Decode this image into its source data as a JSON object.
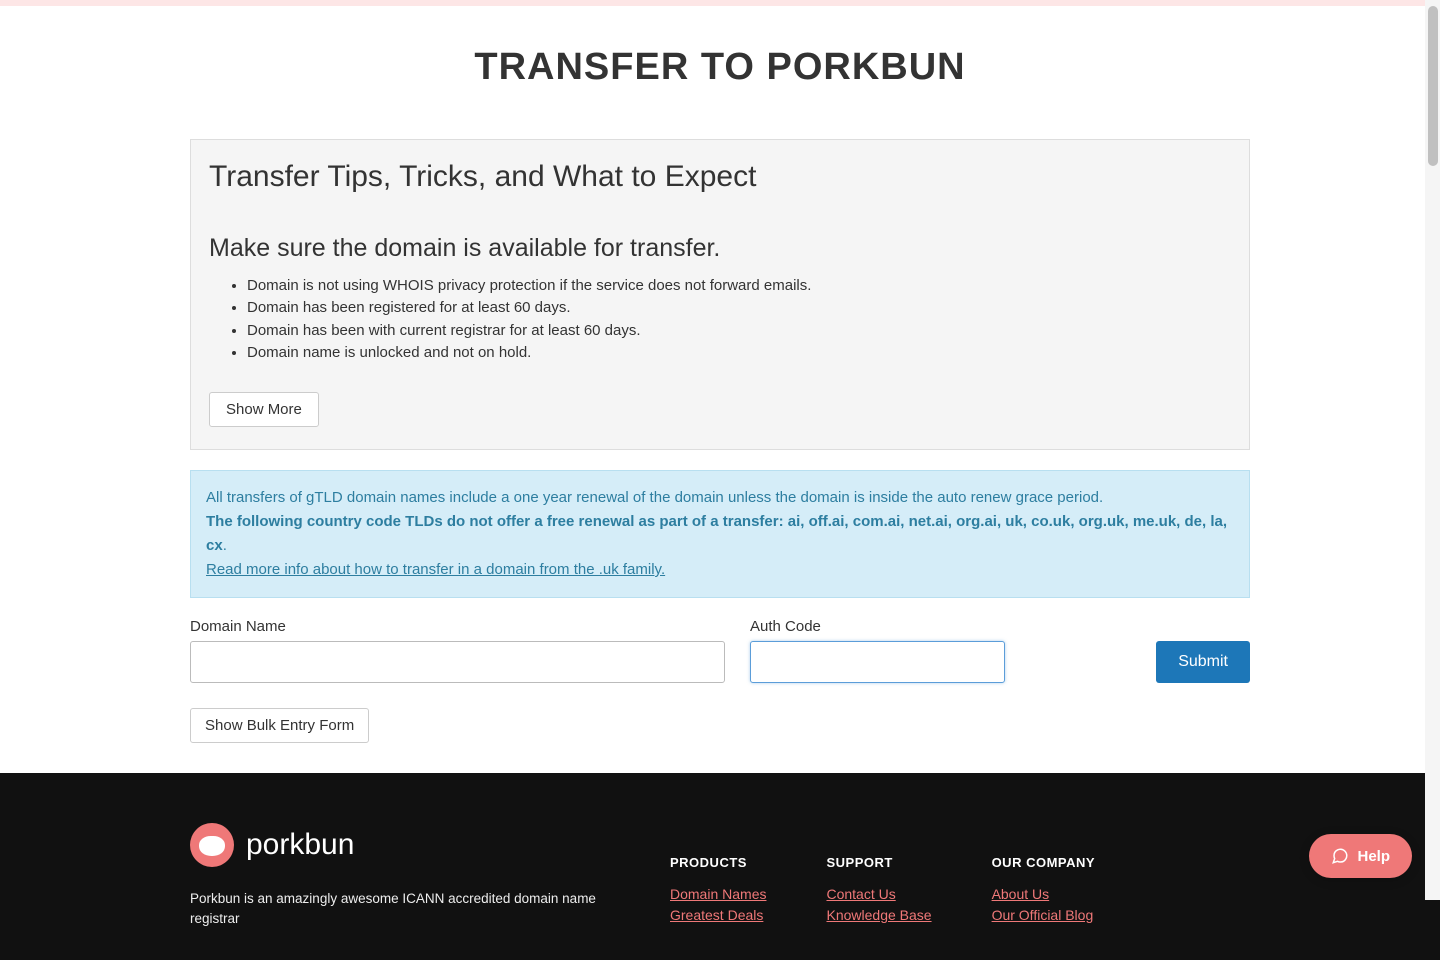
{
  "page_title": "TRANSFER TO PORKBUN",
  "tips": {
    "heading": "Transfer Tips, Tricks, and What to Expect",
    "subheading": "Make sure the domain is available for transfer.",
    "items": [
      "Domain is not using WHOIS privacy protection if the service does not forward emails.",
      "Domain has been registered for at least 60 days.",
      "Domain has been with current registrar for at least 60 days.",
      "Domain name is unlocked and not on hold."
    ],
    "show_more_label": "Show More"
  },
  "notice": {
    "line1": "All transfers of gTLD domain names include a one year renewal of the domain unless the domain is inside the auto renew grace period.",
    "line2": "The following country code TLDs do not offer a free renewal as part of a transfer: ai, off.ai, com.ai, net.ai, org.ai, uk, co.uk, org.uk, me.uk, de, la, cx",
    "line2_suffix": ".",
    "link_text": "Read more info about how to transfer in a domain from the .uk family."
  },
  "form": {
    "domain_label": "Domain Name",
    "auth_label": "Auth Code",
    "submit_label": "Submit",
    "bulk_label": "Show Bulk Entry Form"
  },
  "footer": {
    "brand": "porkbun",
    "description": "Porkbun is an amazingly awesome ICANN accredited domain name registrar",
    "cols": {
      "products": {
        "heading": "PRODUCTS",
        "links": [
          "Domain Names",
          "Greatest Deals"
        ]
      },
      "support": {
        "heading": "SUPPORT",
        "links": [
          "Contact Us",
          "Knowledge Base"
        ]
      },
      "company": {
        "heading": "OUR COMPANY",
        "links": [
          "About Us",
          "Our Official Blog"
        ]
      }
    }
  },
  "help_widget": {
    "label": "Help"
  }
}
